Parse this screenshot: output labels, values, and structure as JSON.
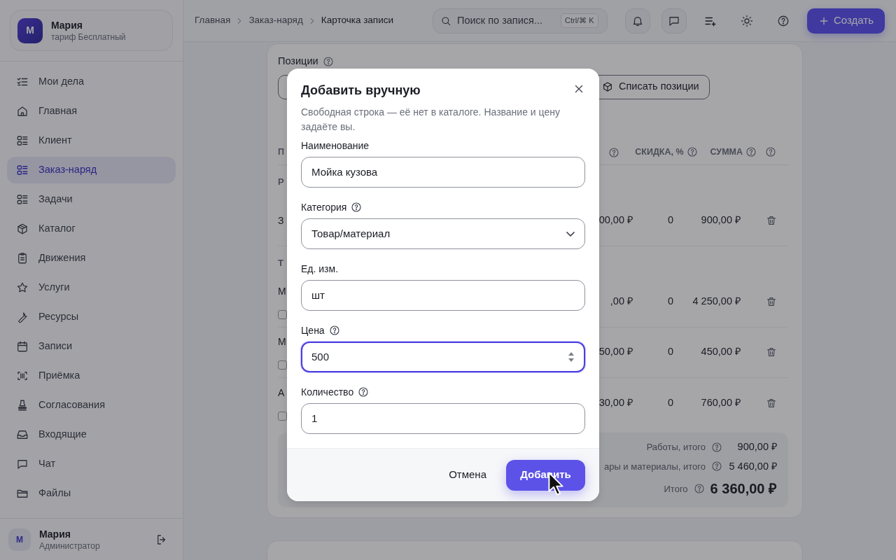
{
  "sidebar": {
    "profile": {
      "initial": "М",
      "name": "Мария",
      "plan": "тариф Бесплатный"
    },
    "items": [
      {
        "label": "Мои дела",
        "selected": false
      },
      {
        "label": "Главная",
        "selected": false
      },
      {
        "label": "Клиент",
        "selected": false
      },
      {
        "label": "Заказ-наряд",
        "selected": true
      },
      {
        "label": "Задачи",
        "selected": false
      },
      {
        "label": "Каталог",
        "selected": false
      },
      {
        "label": "Движения",
        "selected": false
      },
      {
        "label": "Услуги",
        "selected": false
      },
      {
        "label": "Ресурсы",
        "selected": false
      },
      {
        "label": "Записи",
        "selected": false
      },
      {
        "label": "Приёмка",
        "selected": false
      },
      {
        "label": "Согласования",
        "selected": false
      },
      {
        "label": "Входящие",
        "selected": false
      },
      {
        "label": "Чат",
        "selected": false
      },
      {
        "label": "Файлы",
        "selected": false
      }
    ],
    "user": {
      "initial": "М",
      "name": "Мария",
      "role": "Администратор"
    }
  },
  "header": {
    "breadcrumbs": [
      "Главная",
      "Заказ-наряд",
      "Карточка записи"
    ],
    "search": {
      "placeholder": "Поиск по запися...",
      "shortcut": "Ctrl/⌘ K"
    },
    "create_button": "Создать"
  },
  "positions": {
    "title": "Позиции",
    "writeoff_button": "Списать позиции",
    "columns": {
      "first": "П",
      "discount": "СКИДКА, %",
      "sum": "СУММА"
    },
    "rows": [
      {
        "kind": "section",
        "name": "Р"
      },
      {
        "kind": "item",
        "name": "З",
        "price": "00,00 ₽",
        "discount": "0",
        "sum": "900,00 ₽"
      },
      {
        "kind": "section",
        "name": "Т"
      },
      {
        "kind": "item",
        "name": "М",
        "checked": false,
        "price": ",00 ₽",
        "discount": "0",
        "sum": "4 250,00 ₽"
      },
      {
        "kind": "item",
        "name": "М",
        "checked": false,
        "price": "50,00 ₽",
        "discount": "0",
        "sum": "450,00 ₽"
      },
      {
        "kind": "item",
        "name": "А",
        "checked": false,
        "price": "30,00 ₽",
        "discount": "0",
        "sum": "760,00 ₽"
      }
    ],
    "totals": [
      {
        "kind": "subtotal",
        "label": "Работы, итого",
        "value": "900,00 ₽"
      },
      {
        "kind": "subtotal",
        "label": "ары и материалы, итого",
        "value": "5 460,00 ₽"
      },
      {
        "kind": "grand",
        "label": "Итого",
        "value": "6 360,00 ₽"
      }
    ]
  },
  "dialog": {
    "title": "Добавить вручную",
    "description": "Свободная строка — её нет в каталоге. Название и цену задаёте вы.",
    "fields": [
      {
        "label": "Наименование",
        "kind": "text",
        "value": "Мойка кузова",
        "help": false,
        "focused": false
      },
      {
        "label": "Категория",
        "kind": "select",
        "value": "Товар/материал",
        "help": true,
        "focused": false
      },
      {
        "label": "Ед. изм.",
        "kind": "text",
        "value": "шт",
        "help": false,
        "focused": false
      },
      {
        "label": "Цена",
        "kind": "number",
        "value": "500",
        "help": true,
        "focused": true
      },
      {
        "label": "Количество",
        "kind": "text",
        "value": "1",
        "help": true,
        "focused": false
      }
    ],
    "cancel": "Отмена",
    "submit": "Добавить"
  }
}
